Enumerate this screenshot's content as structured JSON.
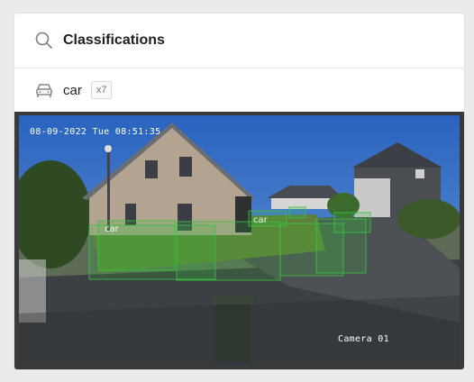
{
  "panel": {
    "title": "Classifications",
    "search_icon": "search-icon"
  },
  "classes": [
    {
      "label": "car",
      "count": "x7",
      "icon": "car-icon"
    }
  ],
  "image": {
    "timestamp": "08-09-2022 Tue 08:51:35",
    "camera_label": "Camera 01",
    "box_labels": [
      "car",
      "car"
    ]
  },
  "colors": {
    "bbox_green": "#39c23f",
    "panel_bg": "#ffffff",
    "page_bg": "#ebebeb"
  }
}
